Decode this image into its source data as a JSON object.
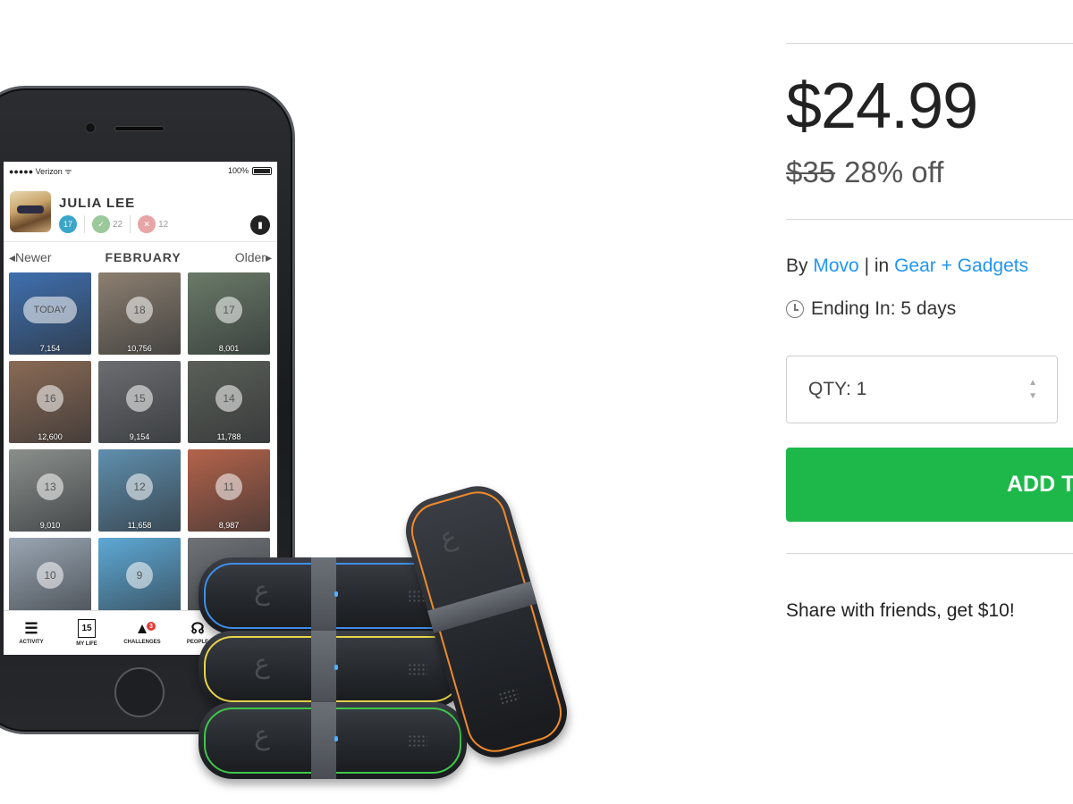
{
  "phone_app": {
    "status": {
      "carrier": "●●●●● Verizon ᯤ",
      "battery": "100%"
    },
    "user": {
      "name": "JULIA LEE",
      "badges": [
        "17",
        "22",
        "12"
      ]
    },
    "month_nav": {
      "newer": "◂Newer",
      "month": "FEBRUARY",
      "older": "Older▸"
    },
    "tiles": [
      {
        "day": "TODAY",
        "steps": "7,154",
        "bg": "#3f6fae"
      },
      {
        "day": "18",
        "steps": "10,756",
        "bg": "#8c7f70"
      },
      {
        "day": "17",
        "steps": "8,001",
        "bg": "#6a7a68"
      },
      {
        "day": "16",
        "steps": "12,600",
        "bg": "#8a6a55"
      },
      {
        "day": "15",
        "steps": "9,154",
        "bg": "#6b6d70"
      },
      {
        "day": "14",
        "steps": "11,788",
        "bg": "#5b5f58"
      },
      {
        "day": "13",
        "steps": "9,010",
        "bg": "#8b8f8c"
      },
      {
        "day": "12",
        "steps": "11,658",
        "bg": "#5f8fae"
      },
      {
        "day": "11",
        "steps": "8,987",
        "bg": "#b4634a"
      },
      {
        "day": "10",
        "steps": "",
        "bg": "#9aa6b3"
      },
      {
        "day": "9",
        "steps": "",
        "bg": "#5ea9d6"
      },
      {
        "day": "",
        "steps": "",
        "bg": "#6f7276"
      }
    ],
    "tabs": [
      {
        "icon": "☰",
        "label": "ACTIVITY"
      },
      {
        "icon": "15",
        "label": "MY LIFE"
      },
      {
        "icon": "▲",
        "label": "CHALLENGES",
        "alert": "3"
      },
      {
        "icon": "☊",
        "label": "PEOPLE"
      }
    ]
  },
  "bands": {
    "ring_colors": [
      "#3f8ee8",
      "#e8d44a",
      "#3fc64a",
      "#f08a2a"
    ]
  },
  "deal": {
    "price": "$24.99",
    "original_price": "$35",
    "discount": "28% off",
    "by_label": "By",
    "vendor": "Movo",
    "separator": "|",
    "in_label": "in",
    "category": "Gear + Gadgets",
    "ending": "Ending In: 5 days",
    "qty_label": "QTY: 1",
    "add_button": "ADD T",
    "share": "Share with friends, get $10!"
  }
}
